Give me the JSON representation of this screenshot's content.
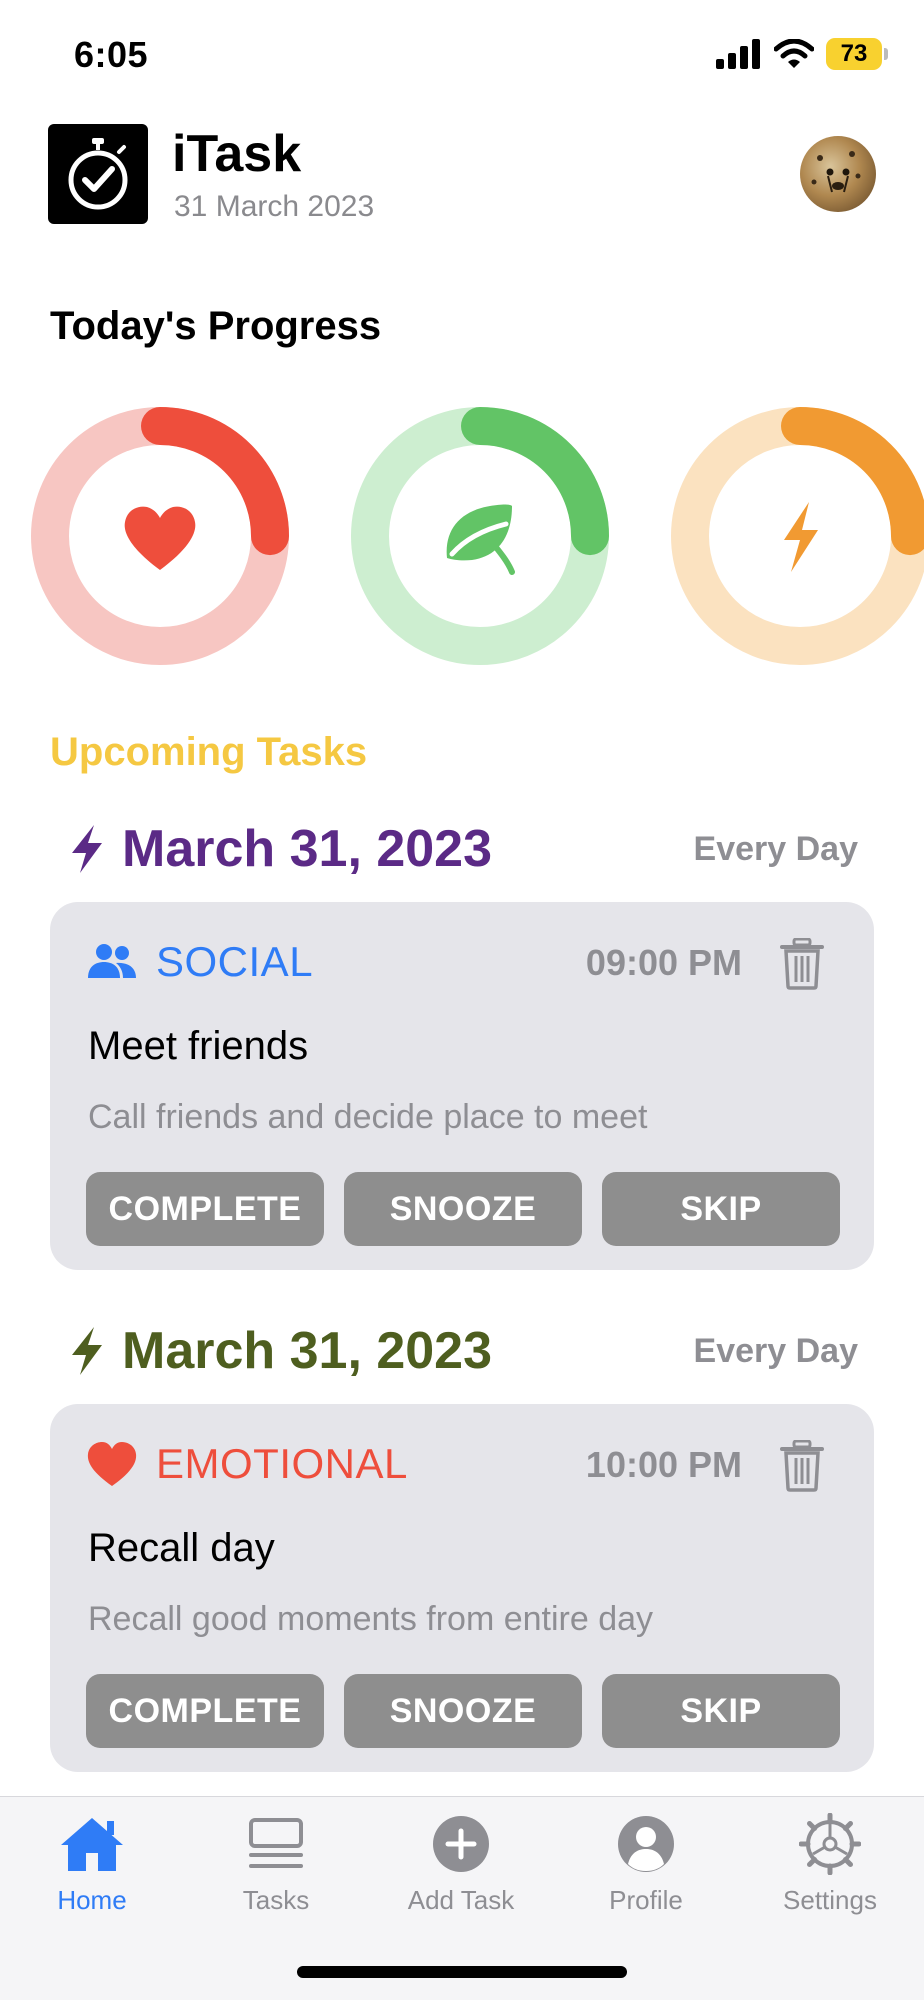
{
  "status_bar": {
    "time": "6:05",
    "battery": "73"
  },
  "header": {
    "app_title": "iTask",
    "date": "31 March 2023"
  },
  "progress": {
    "title": "Today's Progress",
    "rings": [
      {
        "name": "emotional",
        "icon": "heart-icon",
        "progress": 0.25,
        "color": "#ee4e3c",
        "track": "#f7c6c2"
      },
      {
        "name": "health",
        "icon": "leaf-icon",
        "progress": 0.25,
        "color": "#62c466",
        "track": "#cdeed0"
      },
      {
        "name": "energy",
        "icon": "bolt-icon",
        "progress": 0.25,
        "color": "#f19a32",
        "track": "#fbe2c0"
      }
    ]
  },
  "upcoming": {
    "title": "Upcoming Tasks",
    "groups": [
      {
        "date": "March 31, 2023",
        "date_color": "#5b2a86",
        "repeat": "Every Day",
        "task": {
          "category": "SOCIAL",
          "category_color": "#2f7cf6",
          "icon": "people-icon",
          "time": "09:00 PM",
          "title": "Meet friends",
          "description": "Call friends and decide place to meet",
          "actions": {
            "complete": "COMPLETE",
            "snooze": "SNOOZE",
            "skip": "SKIP"
          }
        }
      },
      {
        "date": "March 31, 2023",
        "date_color": "#4e5e1f",
        "repeat": "Every Day",
        "task": {
          "category": "EMOTIONAL",
          "category_color": "#ee4e3c",
          "icon": "heart-icon",
          "time": "10:00 PM",
          "title": "Recall day",
          "description": "Recall good moments from entire day",
          "actions": {
            "complete": "COMPLETE",
            "snooze": "SNOOZE",
            "skip": "SKIP"
          }
        }
      }
    ]
  },
  "tab_bar": {
    "tabs": [
      {
        "label": "Home",
        "icon": "home-icon",
        "active": true
      },
      {
        "label": "Tasks",
        "icon": "tasks-icon",
        "active": false
      },
      {
        "label": "Add Task",
        "icon": "add-icon",
        "active": false
      },
      {
        "label": "Profile",
        "icon": "profile-icon",
        "active": false
      },
      {
        "label": "Settings",
        "icon": "settings-icon",
        "active": false
      }
    ],
    "active_color": "#2f7cf6"
  }
}
